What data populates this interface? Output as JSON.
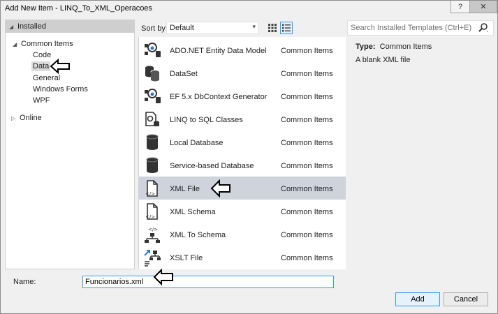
{
  "window": {
    "title": "Add New Item - LINQ_To_XML_Operacoes",
    "help_label": "?",
    "close_label": "✕"
  },
  "left_panel": {
    "installed_label": "Installed",
    "common_items_label": "Common Items",
    "children": [
      "Code",
      "Data",
      "General",
      "Windows Forms",
      "WPF"
    ],
    "selected_child": "Data",
    "online_label": "Online"
  },
  "toolbar": {
    "sort_by_label": "Sort by:",
    "sort_value": "Default",
    "search_placeholder": "Search Installed Templates (Ctrl+E)"
  },
  "items": [
    {
      "name": "ADO.NET Entity Data Model",
      "category": "Common Items",
      "icon": "entity-model-icon"
    },
    {
      "name": "DataSet",
      "category": "Common Items",
      "icon": "dataset-icon"
    },
    {
      "name": "EF 5.x DbContext Generator",
      "category": "Common Items",
      "icon": "dbcontext-generator-icon"
    },
    {
      "name": "LINQ to SQL Classes",
      "category": "Common Items",
      "icon": "linq-to-sql-icon"
    },
    {
      "name": "Local Database",
      "category": "Common Items",
      "icon": "database-icon"
    },
    {
      "name": "Service-based Database",
      "category": "Common Items",
      "icon": "database-icon"
    },
    {
      "name": "XML File",
      "category": "Common Items",
      "icon": "xml-file-icon"
    },
    {
      "name": "XML Schema",
      "category": "Common Items",
      "icon": "xml-schema-icon"
    },
    {
      "name": "XML To Schema",
      "category": "Common Items",
      "icon": "xml-to-schema-icon"
    },
    {
      "name": "XSLT File",
      "category": "Common Items",
      "icon": "xslt-file-icon"
    }
  ],
  "selected_item": "XML File",
  "details": {
    "type_label": "Type:",
    "type_value": "Common Items",
    "description": "A blank XML file"
  },
  "footer": {
    "name_label": "Name:",
    "name_value": "Funcionarios.xml",
    "add_label": "Add",
    "cancel_label": "Cancel"
  },
  "colors": {
    "selection": "#cfd3db",
    "focus_border": "#3399ff",
    "header_bg": "#cfcfcf"
  }
}
